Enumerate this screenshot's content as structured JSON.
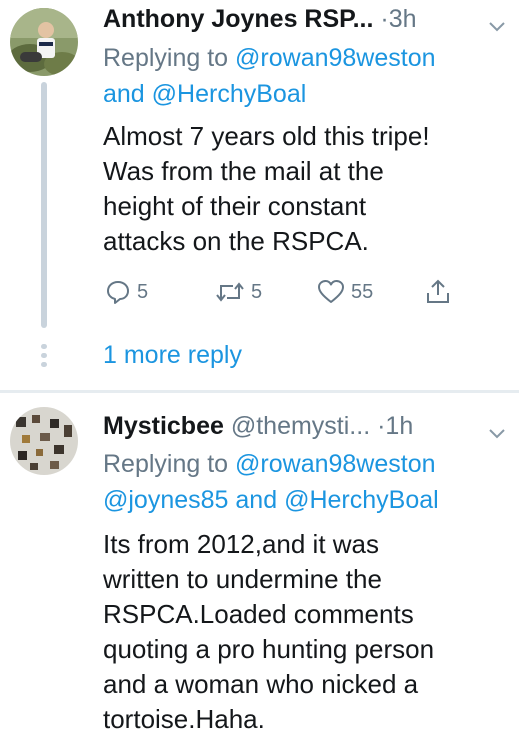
{
  "tweets": [
    {
      "author_name": "Anthony Joynes RSP...",
      "separator": "·",
      "time": "3h",
      "replying_prefix": "Replying to",
      "mentions": [
        "@rowan98weston",
        "and",
        "@HerchyBoal"
      ],
      "body_lines": [
        "Almost 7 years old this tripe!",
        "Was from the mail at the",
        "height of their constant",
        "attacks on the RSPCA."
      ],
      "actions": {
        "reply_count": "5",
        "retweet_count": "5",
        "like_count": "55"
      },
      "more_replies": "1 more reply"
    },
    {
      "author_name": "Mysticbee",
      "handle": "@themysti...",
      "separator": "·",
      "time": "1h",
      "replying_prefix": "Replying to",
      "mentions": [
        "@rowan98weston",
        "@joynes85",
        "and",
        "@HerchyBoal"
      ],
      "body_lines": [
        "Its from 2012,and it was",
        "written to undermine the",
        "RSPCA.Loaded comments",
        "quoting a pro hunting person",
        "and a woman who nicked a",
        "tortoise.Haha."
      ]
    }
  ],
  "icons": [
    "chevron-down-icon",
    "reply-icon",
    "retweet-icon",
    "like-icon",
    "share-icon"
  ],
  "colors": {
    "link": "#1b95e0",
    "secondary_text": "#657786",
    "primary_text": "#14171a",
    "thread_line": "#c9d3dc",
    "divider": "#e6ecf0"
  }
}
